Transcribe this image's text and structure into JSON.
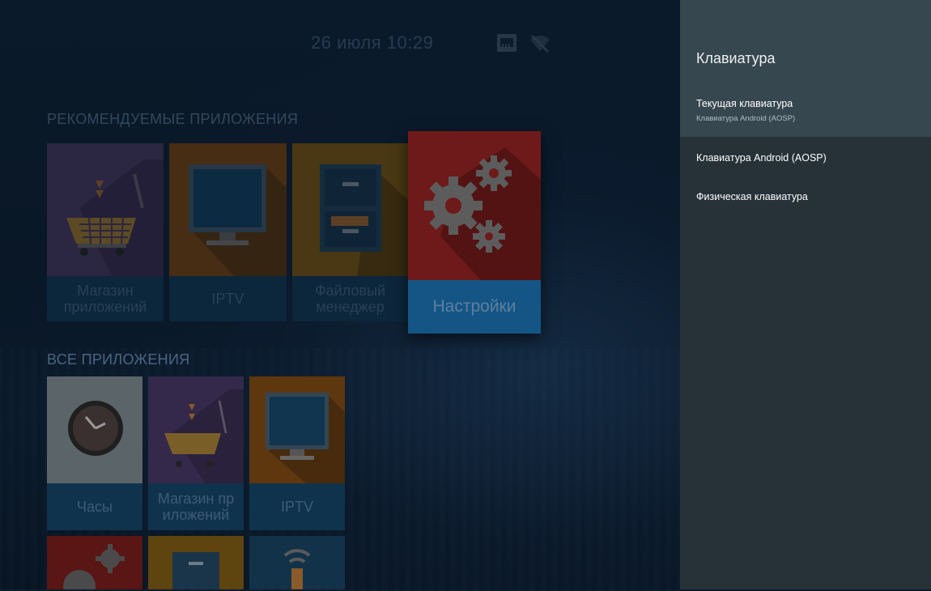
{
  "status_bar": {
    "datetime": "26 июля 10:29",
    "ethernet_icon": "ethernet-icon",
    "wifi_icon": "wifi-off-icon"
  },
  "recommended": {
    "title": "РЕКОМЕНДУЕМЫЕ ПРИЛОЖЕНИЯ",
    "apps": [
      {
        "label": "Магазин приложений",
        "icon": "shopping-cart-icon",
        "color": "#6a4a86"
      },
      {
        "label": "IPTV",
        "icon": "tv-icon",
        "color": "#f57c00"
      },
      {
        "label": "Файловый менеджер",
        "icon": "file-cabinet-icon",
        "color": "#f9a825"
      },
      {
        "label": "Настройки",
        "icon": "gears-icon",
        "color": "#c62828"
      }
    ]
  },
  "all_apps": {
    "title": "ВСЕ ПРИЛОЖЕНИЯ",
    "apps": [
      {
        "label": "Часы",
        "icon": "clock-icon",
        "color": "#cfd8dc"
      },
      {
        "label": "Магазин пр иложений",
        "icon": "shopping-cart-icon",
        "color": "#6a4a86"
      },
      {
        "label": "IPTV",
        "icon": "tv-icon",
        "color": "#f57c00"
      }
    ],
    "row2_icons": [
      "gears-icon",
      "file-cabinet-icon",
      "wifi-remote-icon"
    ]
  },
  "panel": {
    "title": "Клавиатура",
    "items": [
      {
        "title": "Текущая клавиатура",
        "subtitle": "Клавиатура Android (AOSP)"
      },
      {
        "title": "Клавиатура Android (AOSP)"
      },
      {
        "title": "Физическая клавиатура"
      }
    ]
  },
  "colors": {
    "panel_bg": "#263238",
    "panel_header_bg": "#37474f",
    "selected_item_bg": "#37474f",
    "label_bar": "#10334d",
    "focused_label_bar": "#145586"
  }
}
